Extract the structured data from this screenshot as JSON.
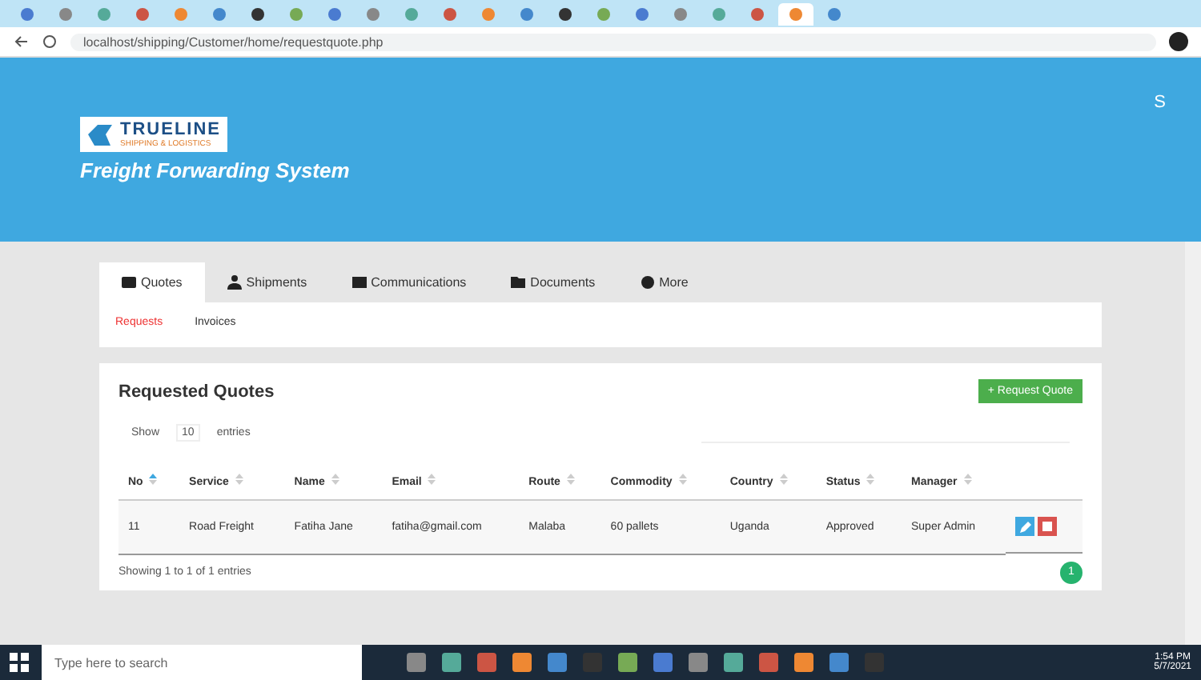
{
  "browser": {
    "tabs": [
      {
        "selected": false
      },
      {
        "selected": false
      },
      {
        "selected": false
      },
      {
        "selected": false
      },
      {
        "selected": false
      },
      {
        "selected": false
      },
      {
        "selected": false
      },
      {
        "selected": false
      },
      {
        "selected": false
      },
      {
        "selected": false
      },
      {
        "selected": false
      },
      {
        "selected": false
      },
      {
        "selected": false
      },
      {
        "selected": false
      },
      {
        "selected": false
      },
      {
        "selected": false
      },
      {
        "selected": false
      },
      {
        "selected": false
      },
      {
        "selected": false
      },
      {
        "selected": false
      },
      {
        "selected": true
      },
      {
        "selected": false
      }
    ],
    "url": "localhost/shipping/Customer/home/requestquote.php"
  },
  "header": {
    "logo": "TRUELINE",
    "logo_sub": "SHIPPING & LOGISTICS",
    "title": "Freight Forwarding System",
    "user_initial": "S"
  },
  "tabs": [
    {
      "label": "Quotes",
      "selected": true
    },
    {
      "label": "Shipments",
      "selected": false
    },
    {
      "label": "Communications",
      "selected": false
    },
    {
      "label": "Documents",
      "selected": false
    },
    {
      "label": "More",
      "selected": false
    }
  ],
  "subtabs": [
    {
      "label": "Requests",
      "selected": true
    },
    {
      "label": "Invoices",
      "selected": false
    }
  ],
  "panel": {
    "title": "Requested Quotes",
    "add_button": "+ Request Quote",
    "show": "Show",
    "page_size": "10",
    "entries": "entries"
  },
  "table": {
    "columns": [
      {
        "label": "No",
        "sorted": true
      },
      {
        "label": "Service",
        "sorted": false
      },
      {
        "label": "Name",
        "sorted": false
      },
      {
        "label": "Email",
        "sorted": false
      },
      {
        "label": "Route",
        "sorted": false
      },
      {
        "label": "Commodity",
        "sorted": false
      },
      {
        "label": "Country",
        "sorted": false
      },
      {
        "label": "Status",
        "sorted": false
      },
      {
        "label": "Manager",
        "sorted": false
      }
    ],
    "rows": [
      [
        "11",
        "Road Freight",
        "Fatiha Jane",
        "fatiha@gmail.com",
        "Malaba",
        "60 pallets",
        "Uganda",
        "Approved",
        "Super Admin"
      ]
    ]
  },
  "footer": {
    "info": "Showing 1 to 1 of 1 entries",
    "page": "1"
  },
  "taskbar": {
    "search": "Type here to search",
    "time": "1:54 PM",
    "date": "5/7/2021"
  }
}
